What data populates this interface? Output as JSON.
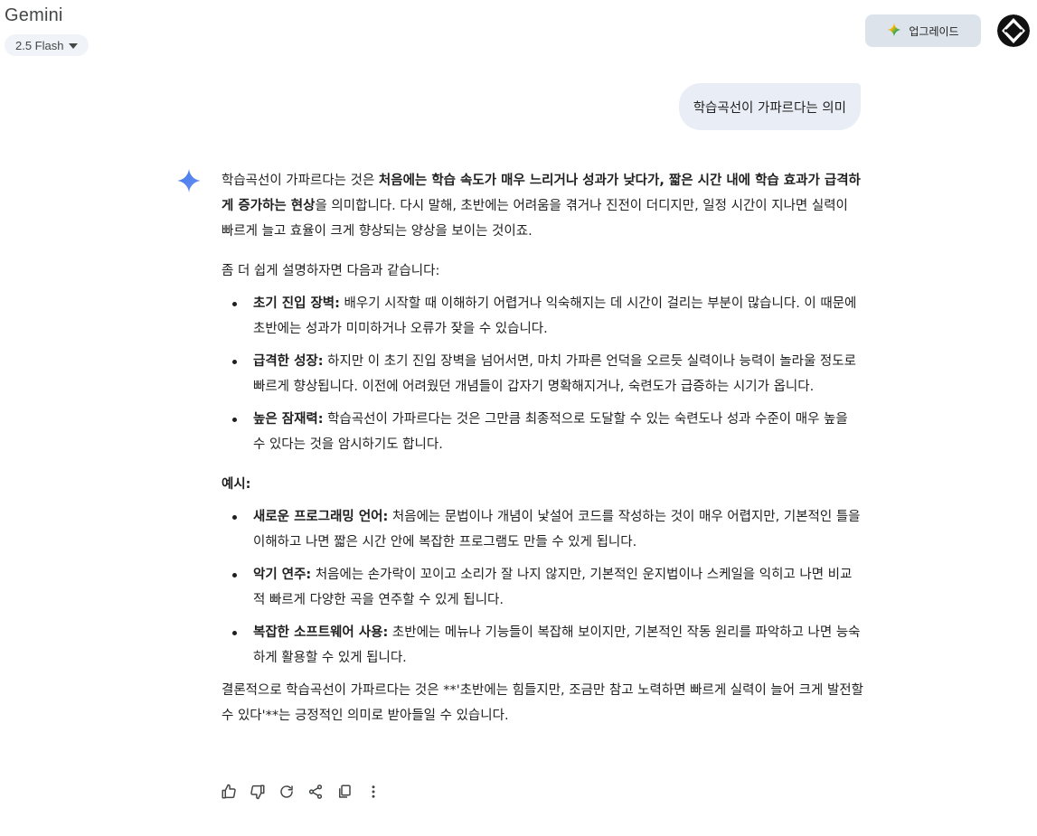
{
  "header": {
    "app_title": "Gemini",
    "model_label": "2.5 Flash",
    "upgrade_label": "업그레이드"
  },
  "user_message": "학습곡선이 가파르다는 의미",
  "response": {
    "intro_prefix": "학습곡선이 가파르다는 것은 ",
    "intro_bold": "처음에는 학습 속도가 매우 느리거나 성과가 낮다가, 짧은 시간 내에 학습 효과가 급격하게 증가하는 현상",
    "intro_suffix": "을 의미합니다. 다시 말해, 초반에는 어려움을 겪거나 진전이 더디지만, 일정 시간이 지나면 실력이 빠르게 늘고 효율이 크게 향상되는 양상을 보이는 것이죠.",
    "lead": "좀 더 쉽게 설명하자면 다음과 같습니다:",
    "points": [
      {
        "title": "초기 진입 장벽:",
        "text": " 배우기 시작할 때 이해하기 어렵거나 익숙해지는 데 시간이 걸리는 부분이 많습니다. 이 때문에 초반에는 성과가 미미하거나 오류가 잦을 수 있습니다."
      },
      {
        "title": "급격한 성장:",
        "text": " 하지만 이 초기 진입 장벽을 넘어서면, 마치 가파른 언덕을 오르듯 실력이나 능력이 놀라울 정도로 빠르게 향상됩니다. 이전에 어려웠던 개념들이 갑자기 명확해지거나, 숙련도가 급증하는 시기가 옵니다."
      },
      {
        "title": "높은 잠재력:",
        "text": " 학습곡선이 가파르다는 것은 그만큼 최종적으로 도달할 수 있는 숙련도나 성과 수준이 매우 높을 수 있다는 것을 암시하기도 합니다."
      }
    ],
    "examples_heading": "예시:",
    "examples": [
      {
        "title": "새로운 프로그래밍 언어:",
        "text": " 처음에는 문법이나 개념이 낯설어 코드를 작성하는 것이 매우 어렵지만, 기본적인 틀을 이해하고 나면 짧은 시간 안에 복잡한 프로그램도 만들 수 있게 됩니다."
      },
      {
        "title": "악기 연주:",
        "text": " 처음에는 손가락이 꼬이고 소리가 잘 나지 않지만, 기본적인 운지법이나 스케일을 익히고 나면 비교적 빠르게 다양한 곡을 연주할 수 있게 됩니다."
      },
      {
        "title": "복잡한 소프트웨어 사용:",
        "text": " 초반에는 메뉴나 기능들이 복잡해 보이지만, 기본적인 작동 원리를 파악하고 나면 능숙하게 활용할 수 있게 됩니다."
      }
    ],
    "conclusion": "결론적으로 학습곡선이 가파르다는 것은 **'초반에는 힘들지만, 조금만 참고 노력하면 빠르게 실력이 늘어 크게 발전할 수 있다'**는 긍정적인 의미로 받아들일 수 있습니다."
  },
  "actions": [
    {
      "name": "thumbs-up-icon"
    },
    {
      "name": "thumbs-down-icon"
    },
    {
      "name": "regenerate-icon"
    },
    {
      "name": "share-icon"
    },
    {
      "name": "copy-icon"
    },
    {
      "name": "more-vert-icon"
    }
  ],
  "colors": {
    "accent_spark": "#4a7ef0",
    "bubble_bg": "#e9eef6",
    "upgrade_bg": "#dde3ea"
  }
}
